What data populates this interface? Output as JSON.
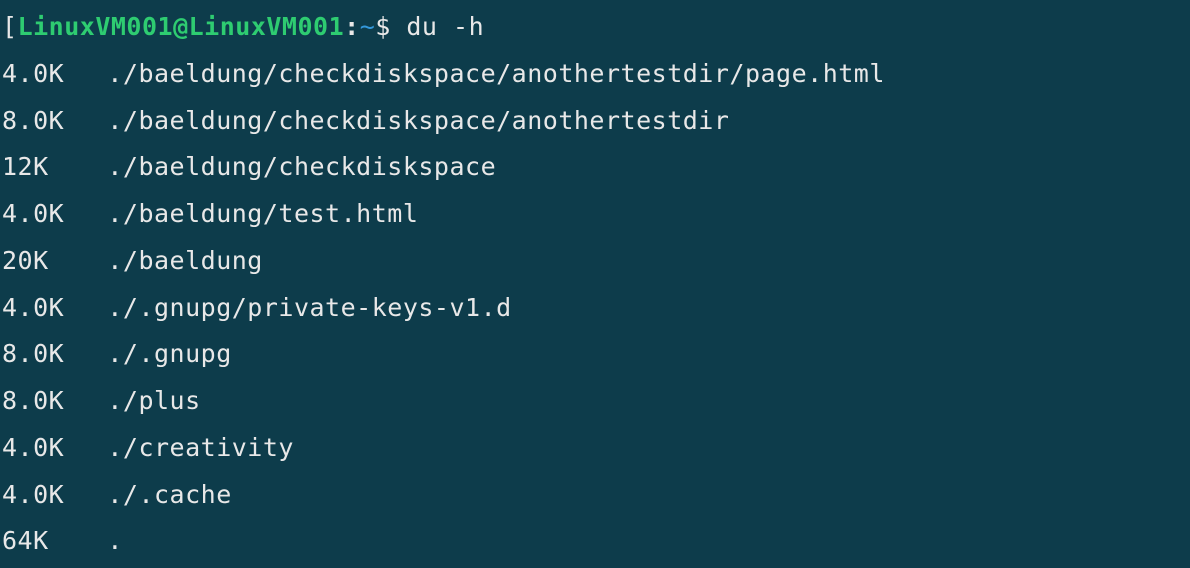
{
  "prompt": {
    "bracket_open": "[",
    "user_host": "LinuxVM001@LinuxVM001",
    "colon": ":",
    "tilde": "~",
    "dollar": "$ ",
    "command": "du -h"
  },
  "output": [
    {
      "size": "4.0K",
      "path": "./baeldung/checkdiskspace/anothertestdir/page.html"
    },
    {
      "size": "8.0K",
      "path": "./baeldung/checkdiskspace/anothertestdir"
    },
    {
      "size": "12K",
      "path": "./baeldung/checkdiskspace"
    },
    {
      "size": "4.0K",
      "path": "./baeldung/test.html"
    },
    {
      "size": "20K",
      "path": "./baeldung"
    },
    {
      "size": "4.0K",
      "path": "./.gnupg/private-keys-v1.d"
    },
    {
      "size": "8.0K",
      "path": "./.gnupg"
    },
    {
      "size": "8.0K",
      "path": "./plus"
    },
    {
      "size": "4.0K",
      "path": "./creativity"
    },
    {
      "size": "4.0K",
      "path": "./.cache"
    },
    {
      "size": "64K",
      "path": "."
    }
  ]
}
